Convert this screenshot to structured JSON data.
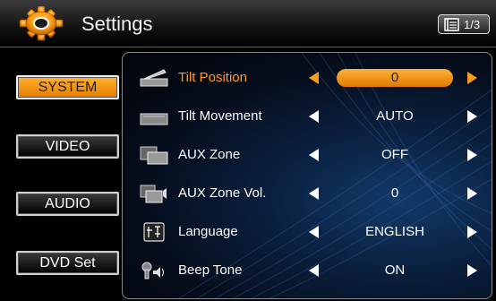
{
  "header": {
    "title": "Settings",
    "page_indicator": "1/3",
    "icon": "gear-icon"
  },
  "nav": [
    {
      "label": "SYSTEM",
      "active": true
    },
    {
      "label": "VIDEO",
      "active": false
    },
    {
      "label": "AUDIO",
      "active": false
    },
    {
      "label": "DVD Set",
      "active": false
    }
  ],
  "settings": [
    {
      "label": "Tilt Position",
      "value": "0",
      "icon": "tilt-position-icon",
      "active": true
    },
    {
      "label": "Tilt Movement",
      "value": "AUTO",
      "icon": "tilt-movement-icon",
      "active": false
    },
    {
      "label": "AUX Zone",
      "value": "OFF",
      "icon": "aux-zone-icon",
      "active": false
    },
    {
      "label": "AUX Zone Vol.",
      "value": "0",
      "icon": "aux-zone-volume-icon",
      "active": false
    },
    {
      "label": "Language",
      "value": "ENGLISH",
      "icon": "language-icon",
      "active": false
    },
    {
      "label": "Beep Tone",
      "value": "ON",
      "icon": "beep-tone-icon",
      "active": false
    }
  ],
  "colors": {
    "accent": "#ff9c1a",
    "panel_bg": "#0a1f3d"
  }
}
